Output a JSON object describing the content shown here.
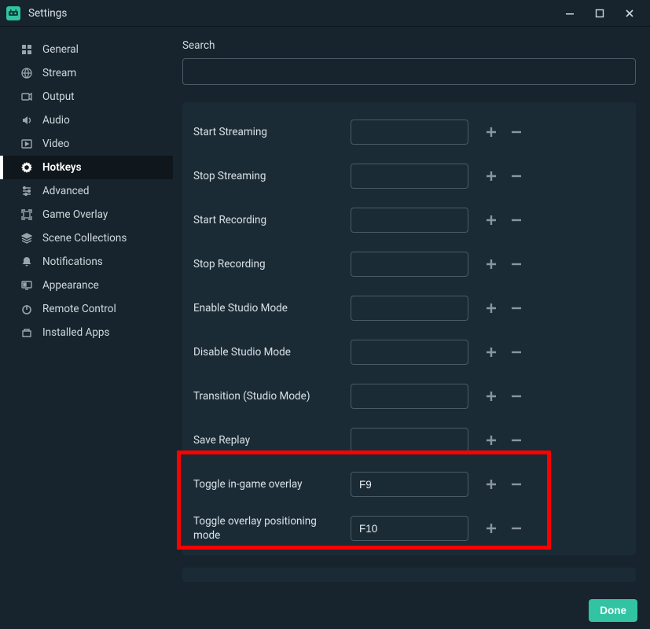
{
  "window": {
    "title": "Settings"
  },
  "sidebar": {
    "items": [
      {
        "label": "General"
      },
      {
        "label": "Stream"
      },
      {
        "label": "Output"
      },
      {
        "label": "Audio"
      },
      {
        "label": "Video"
      },
      {
        "label": "Hotkeys",
        "active": true
      },
      {
        "label": "Advanced"
      },
      {
        "label": "Game Overlay"
      },
      {
        "label": "Scene Collections"
      },
      {
        "label": "Notifications"
      },
      {
        "label": "Appearance"
      },
      {
        "label": "Remote Control"
      },
      {
        "label": "Installed Apps"
      }
    ]
  },
  "search": {
    "label": "Search",
    "value": ""
  },
  "hotkeys": [
    {
      "label": "Start Streaming",
      "value": ""
    },
    {
      "label": "Stop Streaming",
      "value": ""
    },
    {
      "label": "Start Recording",
      "value": ""
    },
    {
      "label": "Stop Recording",
      "value": ""
    },
    {
      "label": "Enable Studio Mode",
      "value": ""
    },
    {
      "label": "Disable Studio Mode",
      "value": ""
    },
    {
      "label": "Transition (Studio Mode)",
      "value": ""
    },
    {
      "label": "Save Replay",
      "value": ""
    },
    {
      "label": "Toggle in-game overlay",
      "value": "F9",
      "highlighted": true
    },
    {
      "label": "Toggle overlay positioning mode",
      "value": "F10",
      "highlighted": true
    }
  ],
  "footer": {
    "done_label": "Done"
  }
}
